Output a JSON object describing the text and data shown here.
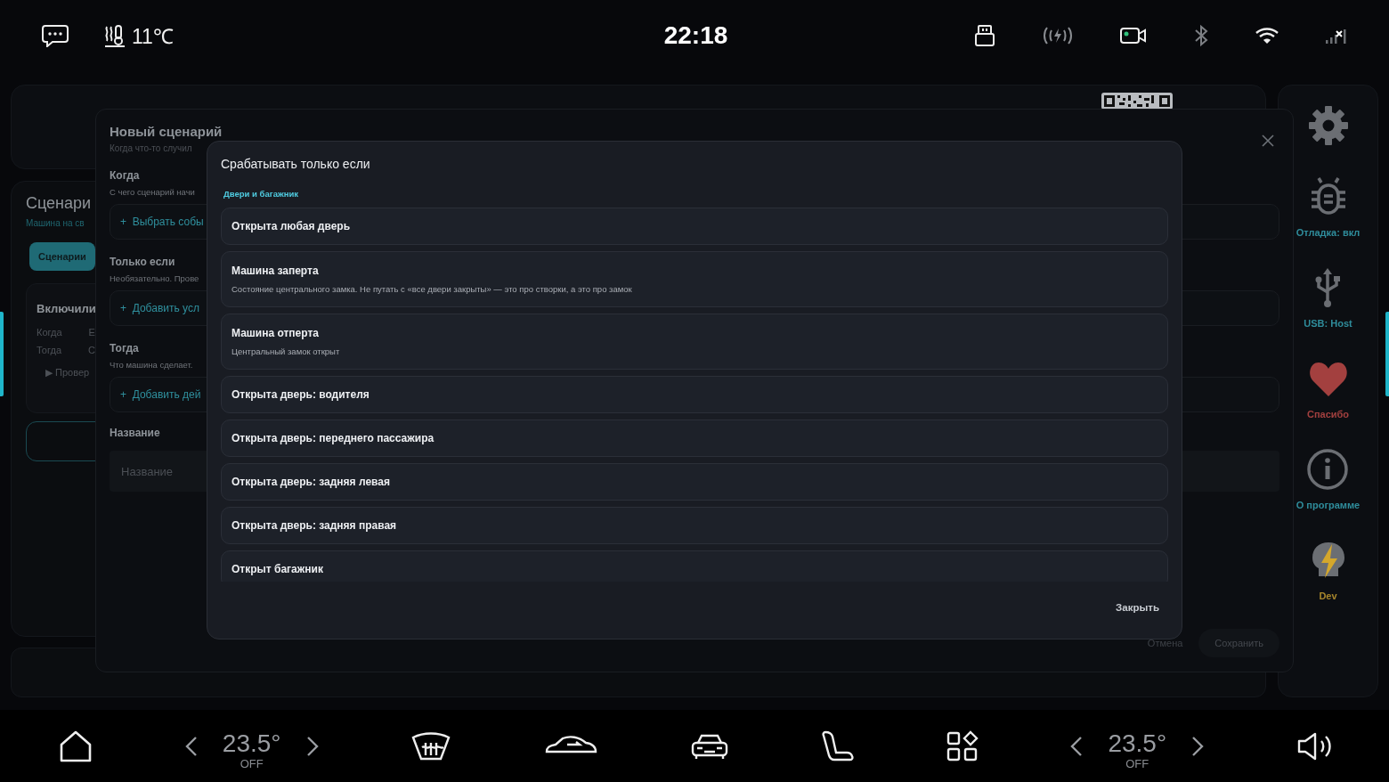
{
  "status_bar": {
    "temperature": "11℃",
    "time": "22:18"
  },
  "screen": {
    "title": "Сценари",
    "subtitle": "Машина на св",
    "tab_button": "Сценарии",
    "card": {
      "title": "Включили",
      "rows": [
        {
          "label": "Когда",
          "value": "Е"
        },
        {
          "label": "Тогда",
          "value": "С"
        }
      ],
      "details": "▶ Провер"
    }
  },
  "dialog": {
    "title": "Новый сценарий",
    "subtitle": "Когда что-то случил",
    "sections": [
      {
        "title": "Когда",
        "hint": "С чего сценарий начи",
        "action": "+  Выбрать собы"
      },
      {
        "title": "Только если",
        "hint": "Необязательно. Прове",
        "action": "+  Добавить усл"
      },
      {
        "title": "Тогда",
        "hint": "Что машина сделает.",
        "action": "+  Добавить дей"
      }
    ],
    "name_label": "Название",
    "name_field": {
      "placeholder": "Название"
    },
    "buttons": [
      {
        "label": "Отмена",
        "kind": "text"
      },
      {
        "label": "Сохранить",
        "kind": "filled"
      }
    ]
  },
  "picker": {
    "title": "Срабатывать только если",
    "group": "Двери и багажник",
    "items": [
      {
        "title": "Открыта любая дверь"
      },
      {
        "title": "Машина заперта",
        "description": "Состояние центрального замка. Не путать с «все двери закрыты» — это про створки, а это про замок"
      },
      {
        "title": "Машина отперта",
        "description": "Центральный замок открыт"
      },
      {
        "title": "Открыта дверь: водителя"
      },
      {
        "title": "Открыта дверь: переднего пассажира"
      },
      {
        "title": "Открыта дверь: задняя левая"
      },
      {
        "title": "Открыта дверь: задняя правая"
      },
      {
        "title": "Открыт багажник"
      }
    ],
    "close": "Закрыть"
  },
  "sidebar": {
    "items": [
      {
        "kind": "gear"
      },
      {
        "kind": "bug",
        "label": "Отладка: вкл",
        "color": "#2f8d9c"
      },
      {
        "kind": "usb",
        "label": "USB: Host",
        "color": "#2f8d9c"
      },
      {
        "kind": "heart",
        "label": "Спасибо",
        "color": "#a3403f"
      },
      {
        "kind": "info",
        "label": "О программе",
        "color": "#2f8d9c"
      },
      {
        "kind": "skull",
        "label": "Dev",
        "color": "#a8862c"
      }
    ]
  },
  "climate": [
    {
      "temperature": "23.5°",
      "mode": "OFF"
    },
    {
      "temperature": "23.5°",
      "mode": "OFF"
    }
  ]
}
